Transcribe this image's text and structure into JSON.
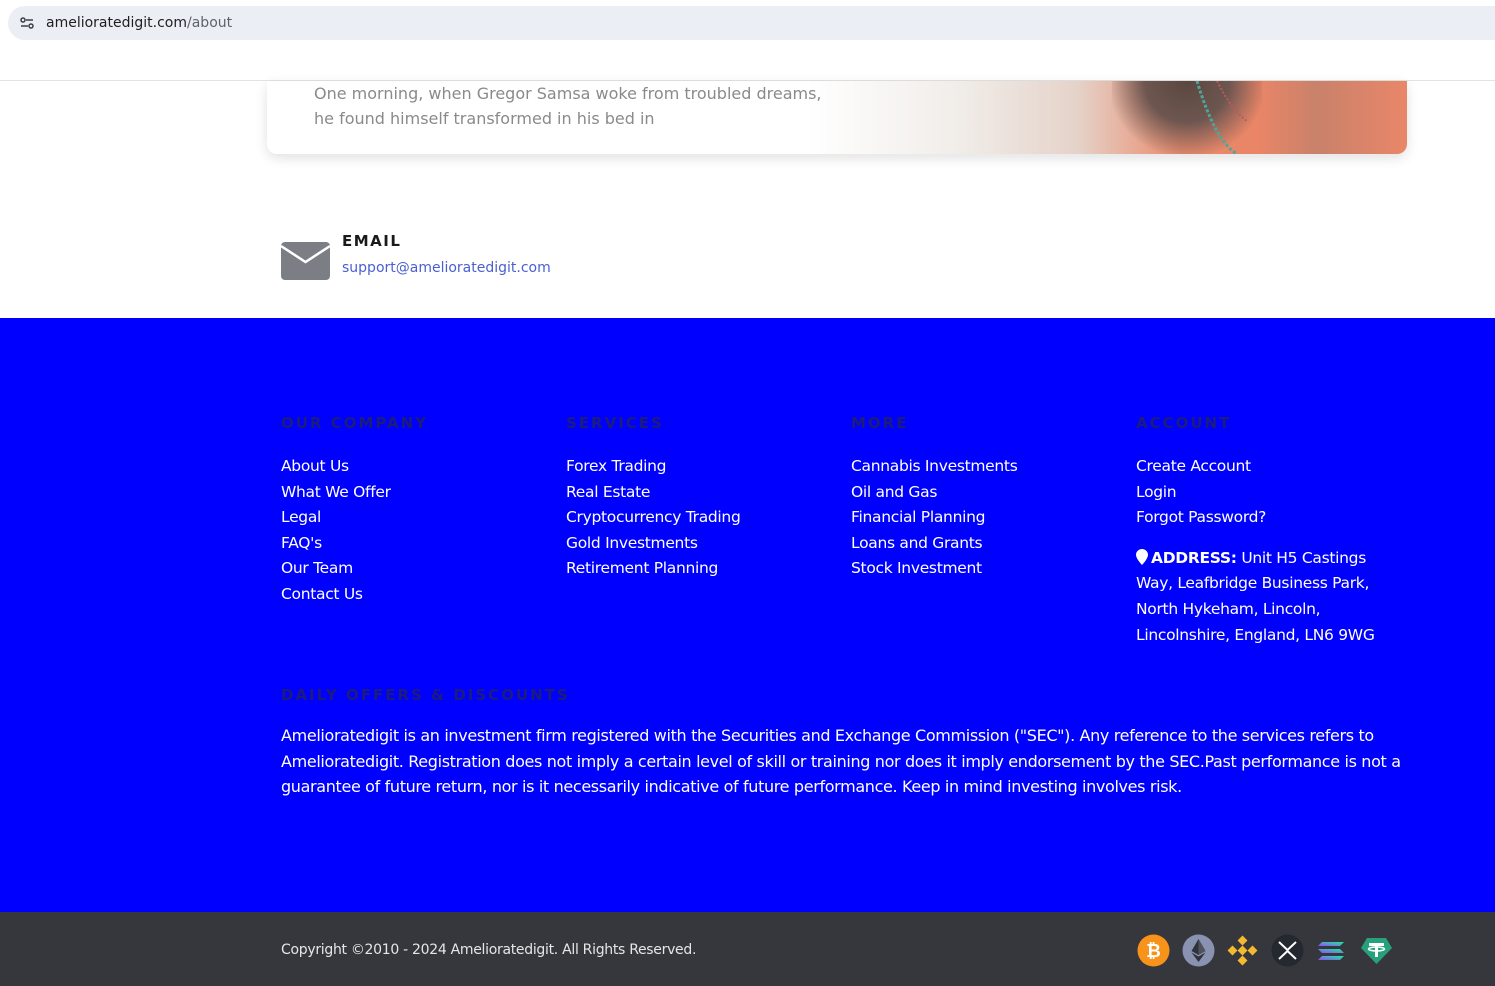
{
  "browser": {
    "url_domain": "amelioratedigit.com",
    "url_path": "/about"
  },
  "hero": {
    "text": "One morning, when Gregor Samsa woke from troubled dreams, he found himself transformed in his bed in"
  },
  "contact": {
    "email_label": "EMAIL",
    "email_value": "support@amelioratedigit.com"
  },
  "footer": {
    "columns": [
      {
        "heading": "OUR COMPANY",
        "links": [
          "About Us",
          "What We Offer",
          "Legal",
          "FAQ's",
          "Our Team",
          "Contact Us"
        ]
      },
      {
        "heading": "SERVICES",
        "links": [
          "Forex Trading",
          "Real Estate",
          "Cryptocurrency Trading",
          "Gold Investments",
          "Retirement Planning"
        ]
      },
      {
        "heading": "MORE",
        "links": [
          "Cannabis Investments",
          "Oil and Gas",
          "Financial Planning",
          "Loans and Grants",
          "Stock Investment"
        ]
      },
      {
        "heading": "ACCOUNT",
        "links": [
          "Create Account",
          "Login",
          "Forgot Password?"
        ]
      }
    ],
    "address_label": "ADDRESS:",
    "address_value": "Unit H5 Castings Way, Leafbridge Business Park, North Hykeham, Lincoln, Lincolnshire, England, LN6 9WG",
    "daily_heading": "DAILY OFFERS & DISCOUNTS",
    "disclaimer": "Amelioratedigit is an investment firm registered with the Securities and Exchange Commission (\"SEC\"). Any reference to the services refers to Amelioratedigit. Registration does not imply a certain level of skill or training nor does it imply endorsement by the SEC.Past performance is not a guarantee of future return, nor is it necessarily indicative of future performance. Keep in mind investing involves risk."
  },
  "bottom": {
    "copyright": "Copyright ©2010 - 2024 Amelioratedigit. All Rights Reserved.",
    "crypto_icons": [
      "bitcoin-icon",
      "ethereum-icon",
      "binance-icon",
      "xrp-icon",
      "solana-icon",
      "tether-icon"
    ]
  },
  "colors": {
    "footer_bg": "#0000ff",
    "bottom_bar_bg": "#35373d",
    "heading_color": "#1c1c7a",
    "email_link": "#4a5fd1"
  }
}
